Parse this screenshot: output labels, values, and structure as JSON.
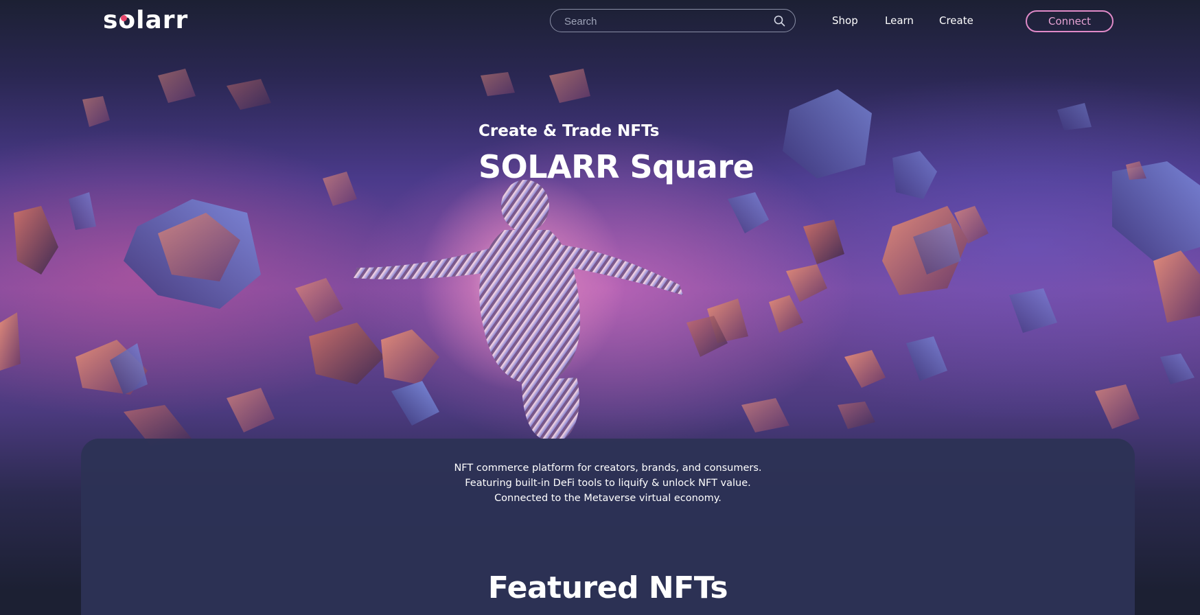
{
  "brand": {
    "logo_text": "solarr",
    "accent_color": "#e8456b"
  },
  "header": {
    "search": {
      "placeholder": "Search"
    },
    "nav": [
      {
        "label": "Shop"
      },
      {
        "label": "Learn"
      },
      {
        "label": "Create"
      }
    ],
    "connect_label": "Connect",
    "connect_color": "#e08ac8"
  },
  "hero": {
    "subtitle": "Create & Trade NFTs",
    "title": "SOLARR Square"
  },
  "info": {
    "lines": [
      "NFT commerce platform for creators, brands, and consumers.",
      "Featuring built-in DeFi tools to liquify & unlock NFT value.",
      "Connected to the Metaverse virtual economy."
    ],
    "featured_heading": "Featured NFTs"
  },
  "icons": {
    "search": "search-icon"
  }
}
